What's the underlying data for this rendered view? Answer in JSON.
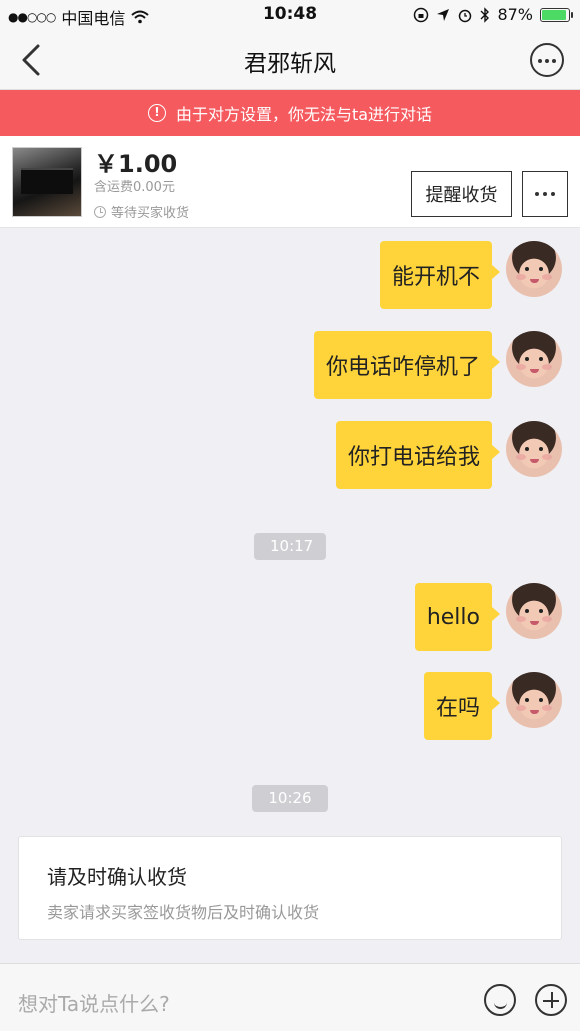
{
  "status_bar": {
    "carrier": "中国电信",
    "time": "10:48",
    "battery": "87%",
    "battery_level": 0.87
  },
  "nav": {
    "title": "君邪斩风"
  },
  "notice": {
    "text": "由于对方设置，你无法与ta进行对话"
  },
  "product": {
    "price": "￥1.00",
    "shipping": "含运费0.00元",
    "status": "等待买家收货",
    "remind_label": "提醒收货"
  },
  "chat": {
    "messages": [
      {
        "text": "能开机不"
      },
      {
        "text": "你电话咋停机了"
      },
      {
        "text": "你打电话给我"
      },
      {
        "text": "hello"
      },
      {
        "text": "在吗"
      }
    ],
    "timestamps": [
      "10:17",
      "10:26"
    ]
  },
  "reminder": {
    "title": "请及时确认收货",
    "desc": "卖家请求买家签收货物后及时确认收货"
  },
  "input": {
    "placeholder": "想对Ta说点什么?"
  },
  "colors": {
    "notice_bg": "#f55a5f",
    "bubble": "#ffd43b",
    "battery": "#4cd964"
  }
}
